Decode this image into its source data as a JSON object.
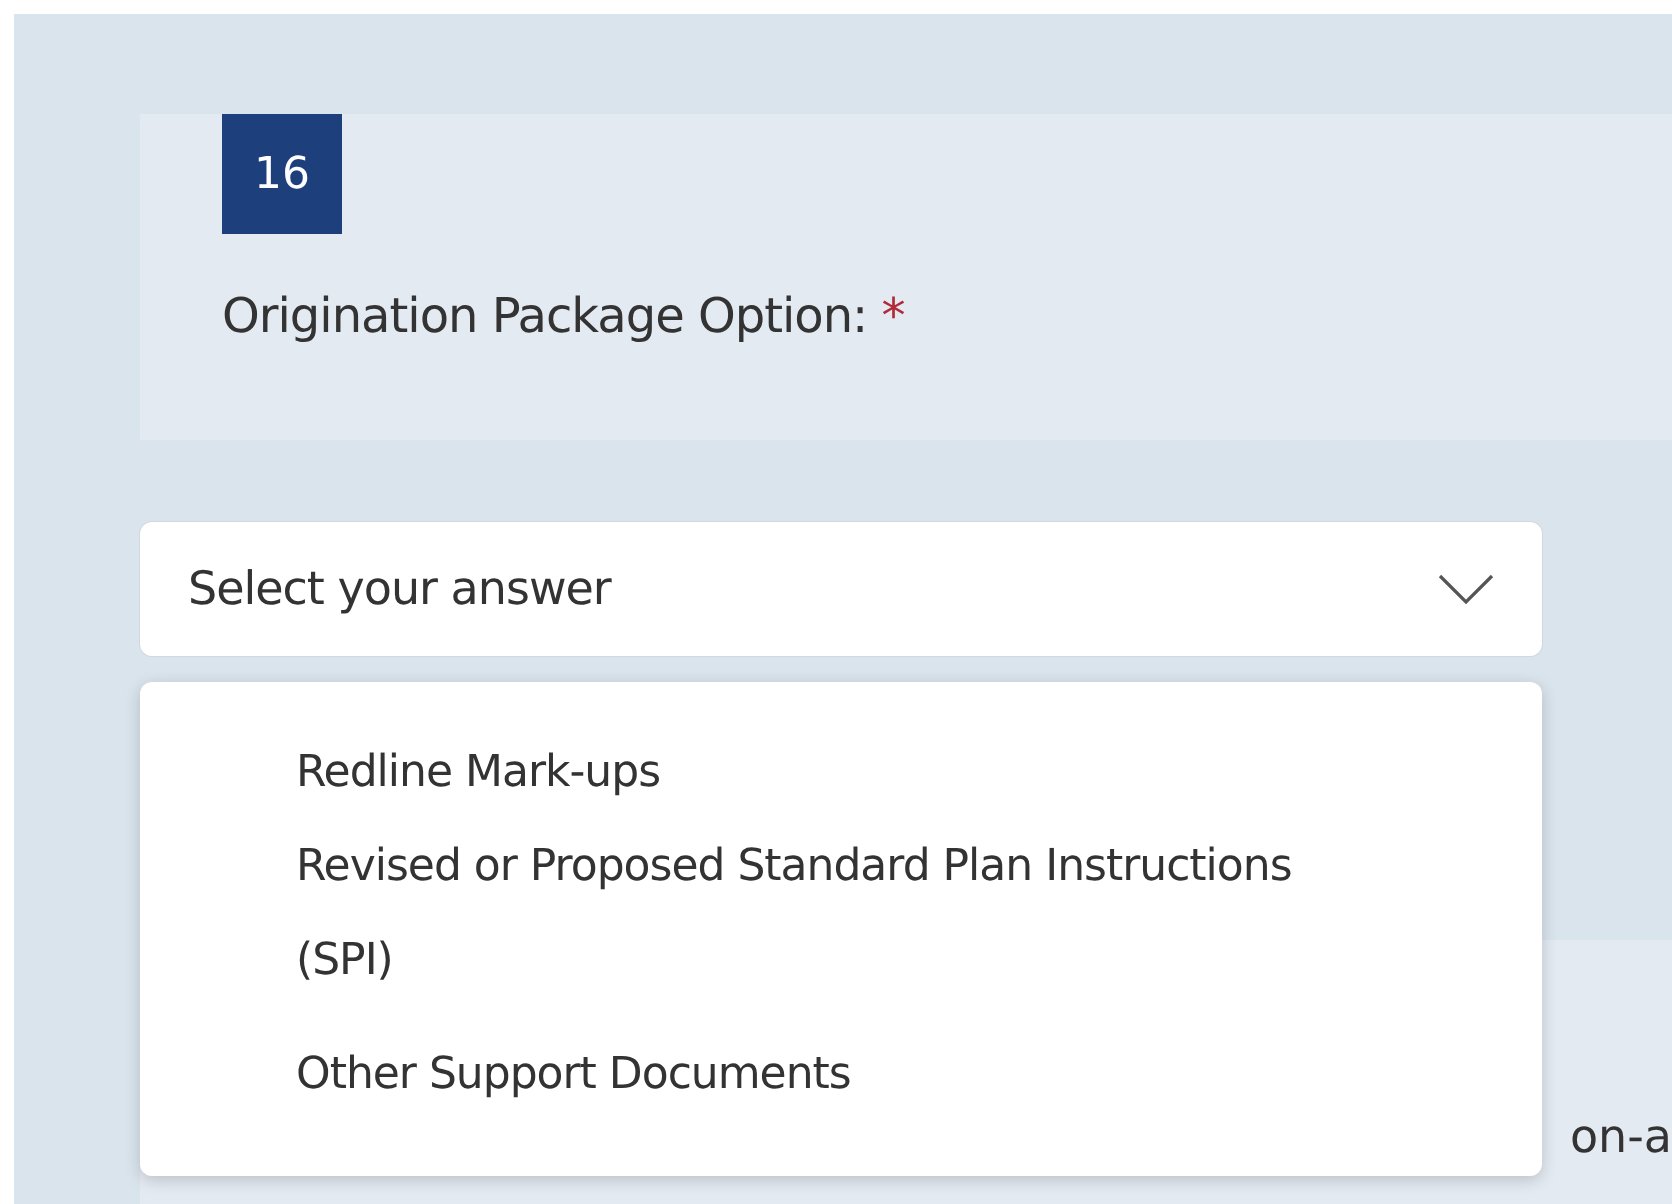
{
  "question": {
    "number": "16",
    "title": "Origination Package Option:",
    "required_mark": "*"
  },
  "dropdown": {
    "placeholder": "Select your answer",
    "expanded": true,
    "options": [
      {
        "label": "Redline Mark-ups",
        "selected": false
      },
      {
        "label": "Revised or Proposed Standard Plan Instructions (SPI)",
        "selected": false
      },
      {
        "label": "Other Support Documents",
        "selected": false
      }
    ]
  },
  "next_card": {
    "text_fragment": "on-a"
  }
}
